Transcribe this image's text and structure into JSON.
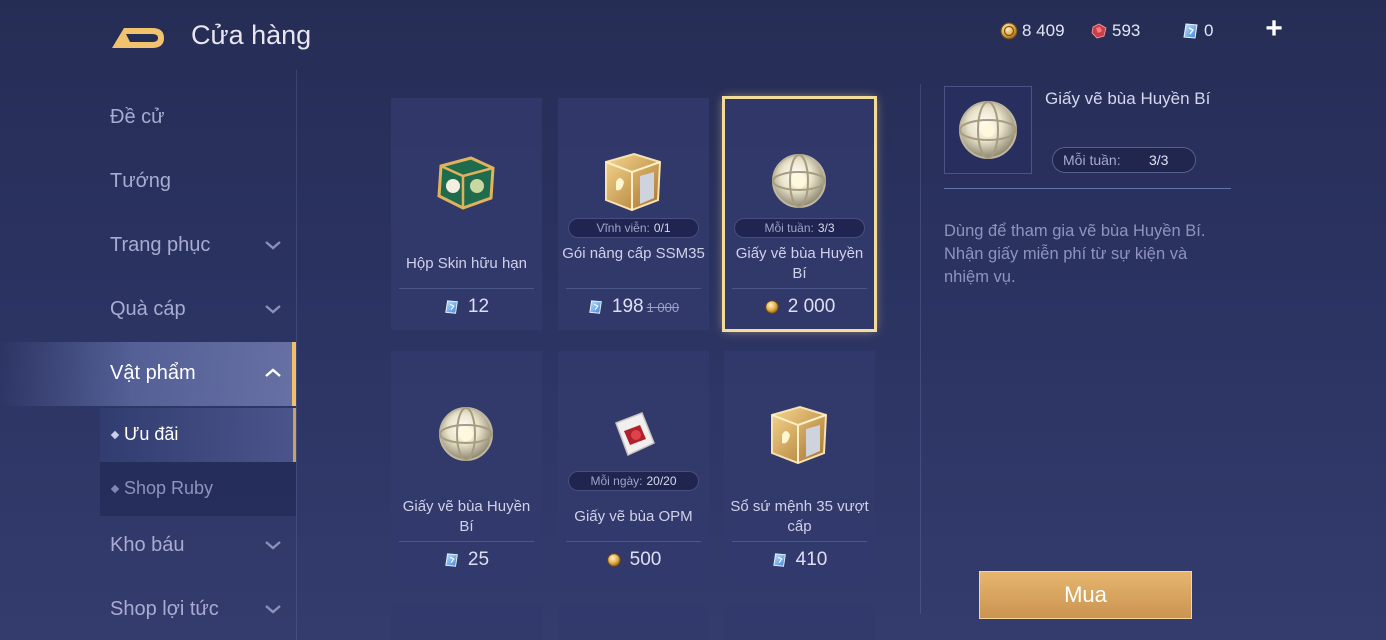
{
  "header": {
    "title": "Cửa hàng",
    "currencies": [
      {
        "icon": "gold-coin-icon",
        "value": "8 409"
      },
      {
        "icon": "ruby-gem-icon",
        "value": "593"
      },
      {
        "icon": "quan-huy-voucher-icon",
        "value": "0"
      }
    ],
    "plus_label": "+"
  },
  "sidebar": {
    "items": [
      {
        "label": "Đề cử"
      },
      {
        "label": "Tướng"
      },
      {
        "label": "Trang phục"
      },
      {
        "label": "Quà cáp"
      },
      {
        "label": "Vật phẩm"
      },
      {
        "label": "Kho báu"
      },
      {
        "label": "Shop lợi tức"
      }
    ],
    "subitems": [
      {
        "label": "Ưu đãi"
      },
      {
        "label": "Shop Ruby"
      }
    ]
  },
  "grid": {
    "cards": [
      {
        "name": "Hộp Skin hữu hạn",
        "limit_label": "",
        "limit_value": "",
        "price": "12",
        "old_price": "",
        "currency": "voucher"
      },
      {
        "name": "Gói nâng cấp SSM35",
        "limit_label": "Vĩnh viễn:",
        "limit_value": "0/1",
        "price": "198",
        "old_price": "1 000",
        "currency": "voucher"
      },
      {
        "name": "Giấy vẽ bùa Huyền Bí",
        "limit_label": "Mỗi tuần:",
        "limit_value": "3/3",
        "price": "2 000",
        "old_price": "",
        "currency": "gold"
      },
      {
        "name": "Giấy vẽ bùa Huyền Bí",
        "limit_label": "",
        "limit_value": "",
        "price": "25",
        "old_price": "",
        "currency": "voucher"
      },
      {
        "name": "Giấy vẽ bùa OPM",
        "limit_label": "Mỗi ngày:",
        "limit_value": "20/20",
        "price": "500",
        "old_price": "",
        "currency": "gold"
      },
      {
        "name": "Sổ sứ mệnh 35 vượt cấp",
        "limit_label": "",
        "limit_value": "",
        "price": "410",
        "old_price": "",
        "currency": "voucher"
      }
    ]
  },
  "detail": {
    "name": "Giấy vẽ bùa Huyền Bí",
    "limit_label": "Mỗi tuần:",
    "limit_value": "3/3",
    "description": "Dùng để tham gia vẽ bùa Huyền Bí. Nhận giấy miễn phí từ sự kiện và nhiệm vụ.",
    "buy_label": "Mua"
  },
  "colors": {
    "accent_gold": "#f0c06c",
    "selected_outline": "#f3dc9b",
    "buy_button": "#d9a45d",
    "background": "#2a3260"
  }
}
